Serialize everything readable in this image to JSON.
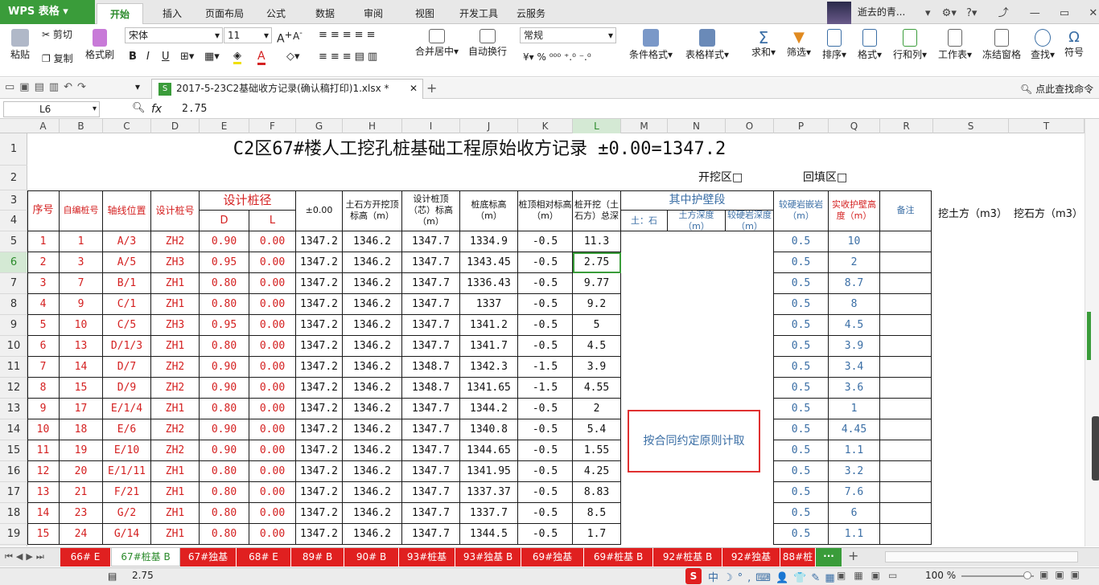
{
  "app": {
    "logo": "WPS 表格",
    "user": "逝去的青...",
    "help": "?"
  },
  "menu_tabs": [
    "开始",
    "插入",
    "页面布局",
    "公式",
    "数据",
    "审阅",
    "视图",
    "开发工具",
    "云服务"
  ],
  "ribbon": {
    "paste": "粘贴",
    "cut": "剪切",
    "copy": "复制",
    "format_painter": "格式刷",
    "font_name": "宋体",
    "font_size": "11",
    "number_format": "常规",
    "merge_center": "合并居中",
    "wrap_text": "自动换行",
    "cond_format": "条件格式",
    "table_style": "表格样式",
    "sum": "求和",
    "filter": "筛选",
    "sort": "排序",
    "format": "格式",
    "row_col": "行和列",
    "worksheet": "工作表",
    "freeze": "冻结窗格",
    "find": "查找",
    "symbol": "符号",
    "percent": "%"
  },
  "document": {
    "tab_title": "2017-5-23C2基础收方记录(确认稿打印)1.xlsx *",
    "find_cmd": "点此查找命令"
  },
  "formula_bar": {
    "cell_ref": "L6",
    "fx": "fx",
    "value": "2.75"
  },
  "columns": [
    "A",
    "B",
    "C",
    "D",
    "E",
    "F",
    "G",
    "H",
    "I",
    "J",
    "K",
    "L",
    "M",
    "N",
    "O",
    "P",
    "Q",
    "R",
    "S",
    "T"
  ],
  "rows_numbers": [
    "1",
    "2",
    "3",
    "4",
    "5",
    "6",
    "7",
    "8",
    "9",
    "10",
    "11",
    "12",
    "13",
    "14",
    "15",
    "16",
    "17",
    "18",
    "19"
  ],
  "sheet": {
    "title": "C2区67#楼人工挖孔桩基础工程原始收方记录  ±0.00=1347.2",
    "open_area": "开挖区□",
    "backfill_area": "回填区□",
    "headers": {
      "seq": "序号",
      "pile_no": "自编桩号",
      "axis": "轴线位置",
      "design_pile": "设计桩号",
      "design_diam": "设计桩径",
      "D": "D",
      "L": "L",
      "zero": "±0.00",
      "earth_top": "土石方开挖顶标高（m）",
      "design_top": "设计桩顶（芯）标高（m）",
      "bottom": "桩底标高（m）",
      "rel_top": "桩顶相对标高（m）",
      "total_depth": "桩开挖（土石方）总深",
      "wall_seg": "其中护壁段",
      "earth_stone": "土：石",
      "earth_depth": "土方深度（m）",
      "hard_rock_depth": "较硬岩深度（m）",
      "hard_rock_embed": "较硬岩嵌岩（m）",
      "actual_wall": "实收护壁高度（m）",
      "remark": "备注",
      "dig_earth": "挖土方（m3）",
      "dig_stone": "挖石方（m3）"
    },
    "note": "按合同约定原则计取",
    "rows": [
      {
        "seq": "1",
        "pile": "1",
        "axis": "A/3",
        "dp": "ZH2",
        "d": "0.90",
        "l": "0.00",
        "z": "1347.2",
        "et": "1346.2",
        "dt": "1347.7",
        "bt": "1334.9",
        "rt": "-0.5",
        "td": "11.3",
        "p": "0.5",
        "q": "10"
      },
      {
        "seq": "2",
        "pile": "3",
        "axis": "A/5",
        "dp": "ZH3",
        "d": "0.95",
        "l": "0.00",
        "z": "1347.2",
        "et": "1346.2",
        "dt": "1347.7",
        "bt": "1343.45",
        "rt": "-0.5",
        "td": "2.75",
        "p": "0.5",
        "q": "2"
      },
      {
        "seq": "3",
        "pile": "7",
        "axis": "B/1",
        "dp": "ZH1",
        "d": "0.80",
        "l": "0.00",
        "z": "1347.2",
        "et": "1346.2",
        "dt": "1347.7",
        "bt": "1336.43",
        "rt": "-0.5",
        "td": "9.77",
        "p": "0.5",
        "q": "8.7"
      },
      {
        "seq": "4",
        "pile": "9",
        "axis": "C/1",
        "dp": "ZH1",
        "d": "0.80",
        "l": "0.00",
        "z": "1347.2",
        "et": "1346.2",
        "dt": "1347.7",
        "bt": "1337",
        "rt": "-0.5",
        "td": "9.2",
        "p": "0.5",
        "q": "8"
      },
      {
        "seq": "5",
        "pile": "10",
        "axis": "C/5",
        "dp": "ZH3",
        "d": "0.95",
        "l": "0.00",
        "z": "1347.2",
        "et": "1346.2",
        "dt": "1347.7",
        "bt": "1341.2",
        "rt": "-0.5",
        "td": "5",
        "p": "0.5",
        "q": "4.5"
      },
      {
        "seq": "6",
        "pile": "13",
        "axis": "D/1/3",
        "dp": "ZH1",
        "d": "0.80",
        "l": "0.00",
        "z": "1347.2",
        "et": "1346.2",
        "dt": "1347.7",
        "bt": "1341.7",
        "rt": "-0.5",
        "td": "4.5",
        "p": "0.5",
        "q": "3.9"
      },
      {
        "seq": "7",
        "pile": "14",
        "axis": "D/7",
        "dp": "ZH2",
        "d": "0.90",
        "l": "0.00",
        "z": "1347.2",
        "et": "1346.2",
        "dt": "1348.7",
        "bt": "1342.3",
        "rt": "-1.5",
        "td": "3.9",
        "p": "0.5",
        "q": "3.4"
      },
      {
        "seq": "8",
        "pile": "15",
        "axis": "D/9",
        "dp": "ZH2",
        "d": "0.90",
        "l": "0.00",
        "z": "1347.2",
        "et": "1346.2",
        "dt": "1348.7",
        "bt": "1341.65",
        "rt": "-1.5",
        "td": "4.55",
        "p": "0.5",
        "q": "3.6"
      },
      {
        "seq": "9",
        "pile": "17",
        "axis": "E/1/4",
        "dp": "ZH1",
        "d": "0.80",
        "l": "0.00",
        "z": "1347.2",
        "et": "1346.2",
        "dt": "1347.7",
        "bt": "1344.2",
        "rt": "-0.5",
        "td": "2",
        "p": "0.5",
        "q": "1"
      },
      {
        "seq": "10",
        "pile": "18",
        "axis": "E/6",
        "dp": "ZH2",
        "d": "0.90",
        "l": "0.00",
        "z": "1347.2",
        "et": "1346.2",
        "dt": "1347.7",
        "bt": "1340.8",
        "rt": "-0.5",
        "td": "5.4",
        "p": "0.5",
        "q": "4.45"
      },
      {
        "seq": "11",
        "pile": "19",
        "axis": "E/10",
        "dp": "ZH2",
        "d": "0.90",
        "l": "0.00",
        "z": "1347.2",
        "et": "1346.2",
        "dt": "1347.7",
        "bt": "1344.65",
        "rt": "-0.5",
        "td": "1.55",
        "p": "0.5",
        "q": "1.1"
      },
      {
        "seq": "12",
        "pile": "20",
        "axis": "E/1/11",
        "dp": "ZH1",
        "d": "0.80",
        "l": "0.00",
        "z": "1347.2",
        "et": "1346.2",
        "dt": "1347.7",
        "bt": "1341.95",
        "rt": "-0.5",
        "td": "4.25",
        "p": "0.5",
        "q": "3.2"
      },
      {
        "seq": "13",
        "pile": "21",
        "axis": "F/21",
        "dp": "ZH1",
        "d": "0.80",
        "l": "0.00",
        "z": "1347.2",
        "et": "1346.2",
        "dt": "1347.7",
        "bt": "1337.37",
        "rt": "-0.5",
        "td": "8.83",
        "p": "0.5",
        "q": "7.6"
      },
      {
        "seq": "14",
        "pile": "23",
        "axis": "G/2",
        "dp": "ZH1",
        "d": "0.80",
        "l": "0.00",
        "z": "1347.2",
        "et": "1346.2",
        "dt": "1347.7",
        "bt": "1337.7",
        "rt": "-0.5",
        "td": "8.5",
        "p": "0.5",
        "q": "6"
      },
      {
        "seq": "15",
        "pile": "24",
        "axis": "G/14",
        "dp": "ZH1",
        "d": "0.80",
        "l": "0.00",
        "z": "1347.2",
        "et": "1346.2",
        "dt": "1347.7",
        "bt": "1344.5",
        "rt": "-0.5",
        "td": "1.7",
        "p": "0.5",
        "q": "1.1"
      }
    ]
  },
  "sheet_tabs": [
    "66# E",
    "67#桩基 B",
    "67#独基",
    "68# E",
    "89# B",
    "90# B",
    "93#桩基",
    "93#独基 B",
    "69#独基",
    "69#桩基 B",
    "92#桩基 B",
    "92#独基",
    "88#桩"
  ],
  "active_sheet": 1,
  "status": {
    "value": "2.75",
    "zoom": "100 %"
  },
  "colors": {
    "accent": "#2a8a2a",
    "red": "#d42020",
    "blue": "#3a6ea5",
    "tab_red": "#e02020"
  }
}
